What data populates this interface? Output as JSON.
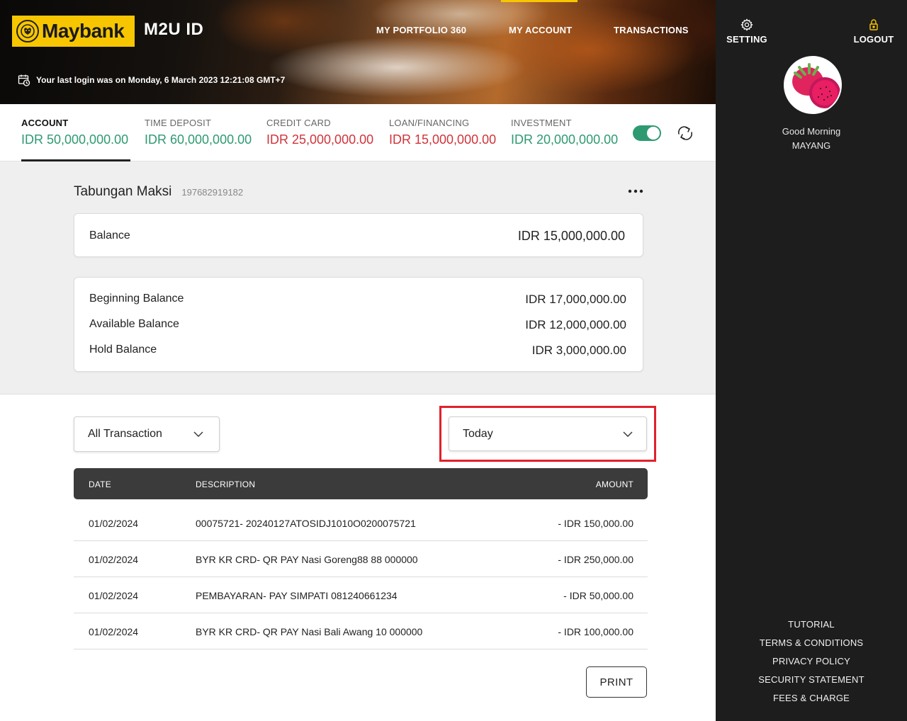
{
  "header": {
    "logo_text": "Maybank",
    "app_title": "M2U ID",
    "nav": [
      {
        "label": "MY PORTFOLIO 360"
      },
      {
        "label": "MY ACCOUNT"
      },
      {
        "label": "TRANSACTIONS"
      }
    ],
    "active_nav_color": "#f7c600",
    "last_login": "Your last login was on Monday, 6 March 2023 12:21:08 GMT+7"
  },
  "summary": {
    "items": [
      {
        "label": "ACCOUNT",
        "value": "IDR 50,000,000.00",
        "color": "#2e9a72"
      },
      {
        "label": "TIME DEPOSIT",
        "value": "IDR 60,000,000.00",
        "color": "#2e9a72"
      },
      {
        "label": "CREDIT CARD",
        "value": "IDR 25,000,000.00",
        "color": "#d0343b"
      },
      {
        "label": "LOAN/FINANCING",
        "value": "IDR 15,000,000.00",
        "color": "#d0343b"
      },
      {
        "label": "INVESTMENT",
        "value": "IDR 20,000,000.00",
        "color": "#2e9a72"
      }
    ],
    "toggle_on": true
  },
  "account": {
    "name": "Tabungan Maksi",
    "number": "197682919182",
    "balance_label": "Balance",
    "balance_value": "IDR 15,000,000.00",
    "details": [
      {
        "label": "Beginning Balance",
        "value": "IDR 17,000,000.00"
      },
      {
        "label": "Available Balance",
        "value": "IDR 12,000,000.00"
      },
      {
        "label": "Hold Balance",
        "value": "IDR 3,000,000.00"
      }
    ]
  },
  "filters": {
    "type_selected": "All Transaction",
    "period_selected": "Today"
  },
  "table": {
    "headers": {
      "date": "DATE",
      "description": "DESCRIPTION",
      "amount": "AMOUNT"
    },
    "rows": [
      {
        "date": "01/02/2024",
        "description": "00075721- 20240127ATOSIDJ1010O0200075721",
        "amount": "- IDR 150,000.00"
      },
      {
        "date": "01/02/2024",
        "description": "BYR KR CRD- QR PAY Nasi Goreng88 88 000000",
        "amount": "- IDR 250,000.00"
      },
      {
        "date": "01/02/2024",
        "description": "PEMBAYARAN- PAY SIMPATI 081240661234",
        "amount": "- IDR 50,000.00"
      },
      {
        "date": "01/02/2024",
        "description": "BYR KR CRD- QR PAY Nasi Bali Awang 10 000000",
        "amount": "- IDR 100,000.00"
      }
    ],
    "print_label": "PRINT"
  },
  "sidebar": {
    "setting_label": "SETTING",
    "logout_label": "LOGOUT",
    "greeting": "Good Morning",
    "user_name": "MAYANG",
    "footer_links": [
      {
        "label": "TUTORIAL"
      },
      {
        "label": "TERMS & CONDITIONS"
      },
      {
        "label": "PRIVACY POLICY"
      },
      {
        "label": "SECURITY STATEMENT"
      },
      {
        "label": "FEES & CHARGE"
      }
    ]
  },
  "icons": {
    "logo": "tiger-head-icon",
    "last_login": "calendar-clock-icon",
    "refresh": "refresh-icon",
    "more": "more-horizontal-icon",
    "dropdown": "chevron-down-icon",
    "setting": "gear-icon",
    "logout": "lock-icon"
  }
}
